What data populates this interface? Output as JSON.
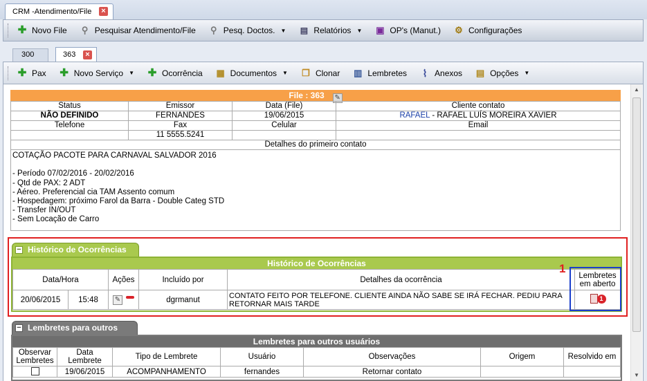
{
  "window": {
    "tab_title": "CRM -Atendimento/File"
  },
  "toolbar1": [
    {
      "label": "Novo File",
      "icon": "plus-icon",
      "dropdown": false
    },
    {
      "label": "Pesquisar Atendimento/File",
      "icon": "search-icon",
      "dropdown": false
    },
    {
      "label": "Pesq. Doctos.",
      "icon": "search-icon",
      "dropdown": true
    },
    {
      "label": "Relatórios",
      "icon": "report-icon",
      "dropdown": true
    },
    {
      "label": "OP's (Manut.)",
      "icon": "window-icon",
      "dropdown": false
    },
    {
      "label": "Configurações",
      "icon": "gears-icon",
      "dropdown": false
    }
  ],
  "filetabs": {
    "tab_a": "300",
    "tab_b": "363"
  },
  "toolbar2": [
    {
      "label": "Pax",
      "icon": "plus-icon",
      "dropdown": false
    },
    {
      "label": "Novo Serviço",
      "icon": "plus-icon",
      "dropdown": true
    },
    {
      "label": "Ocorrência",
      "icon": "plus-icon",
      "dropdown": false
    },
    {
      "label": "Documentos",
      "icon": "documents-icon",
      "dropdown": true
    },
    {
      "label": "Clonar",
      "icon": "clone-icon",
      "dropdown": false
    },
    {
      "label": "Lembretes",
      "icon": "reminders-icon",
      "dropdown": false
    },
    {
      "label": "Anexos",
      "icon": "paperclip-icon",
      "dropdown": false
    },
    {
      "label": "Opções",
      "icon": "options-icon",
      "dropdown": true
    }
  ],
  "file": {
    "header": "File : 363",
    "labels": {
      "status": "Status",
      "emissor": "Emissor",
      "data": "Data (File)",
      "cliente": "Cliente contato",
      "telefone": "Telefone",
      "fax": "Fax",
      "celular": "Celular",
      "email": "Email",
      "detalhes": "Detalhes do primeiro contato"
    },
    "values": {
      "status": "NÃO DEFINIDO",
      "emissor": "FERNANDES",
      "data": "19/06/2015",
      "cliente_link": "RAFAEL",
      "cliente_rest": " - RAFAEL LUÍS MOREIRA XAVIER",
      "telefone": "",
      "fax": "11 5555.5241",
      "celular": "",
      "email": ""
    },
    "details": "COTAÇÃO PACOTE PARA CARNAVAL SALVADOR 2016\n\n- Período 07/02/2016 - 20/02/2016\n- Qtd de PAX: 2 ADT\n- Aéreo. Preferencial cia TAM Assento comum\n- Hospedagem: próximo Farol da Barra - Double Categ STD\n- Transfer IN/OUT\n- Sem Locação de Carro"
  },
  "ocorrencias": {
    "tab_label": "Histórico de Ocorrências",
    "title": "Histórico de Ocorrências",
    "columns": {
      "datahora": "Data/Hora",
      "acoes": "Ações",
      "incluido": "Incluído por",
      "detalhes": "Detalhes da ocorrência",
      "lembretes": "Lembretes em aberto"
    },
    "row": {
      "data": "20/06/2015",
      "hora": "15:48",
      "incluido": "dgrmanut",
      "detalhes": "CONTATO FEITO POR TELEFONE. CLIENTE AINDA NÃO SABE SE IRÁ FECHAR. PEDIU PARA RETORNAR MAIS TARDE",
      "lembretes_count": "1"
    },
    "annotation": "1"
  },
  "lembretes": {
    "tab_label": "Lembretes para outros",
    "title": "Lembretes para outros usuários",
    "columns": [
      "Observar Lembretes",
      "Data Lembrete",
      "Tipo de Lembrete",
      "Usuário",
      "Observações",
      "Origem",
      "Resolvido em"
    ],
    "row": {
      "data": "19/06/2015",
      "tipo": "ACOMPANHAMENTO",
      "usuario": "fernandes",
      "obs": "Retornar contato",
      "origem": "",
      "resolvido": ""
    }
  },
  "colors": {
    "accent_orange": "#f7a048",
    "accent_green": "#a9c94e",
    "highlight_red": "#e02020",
    "highlight_blue": "#1a3fcc",
    "link": "#1a3fa8"
  }
}
